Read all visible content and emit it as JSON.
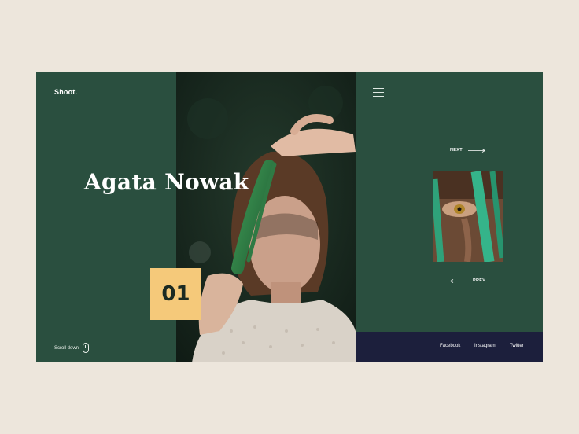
{
  "brand": {
    "logo": "Shoot."
  },
  "hero": {
    "name": "Agata Nowak",
    "number": "01"
  },
  "scroll": {
    "label": "Scroll down"
  },
  "nav": {
    "next_label": "NEXT",
    "prev_label": "PREV"
  },
  "social": {
    "facebook": "Facebook",
    "instagram": "Instagram",
    "twitter": "Twitter"
  },
  "colors": {
    "page_background": "#ede6dc",
    "panel_green": "#2a4f3f",
    "accent_yellow": "#f5c97a",
    "footer_navy": "#1c1f3c"
  }
}
